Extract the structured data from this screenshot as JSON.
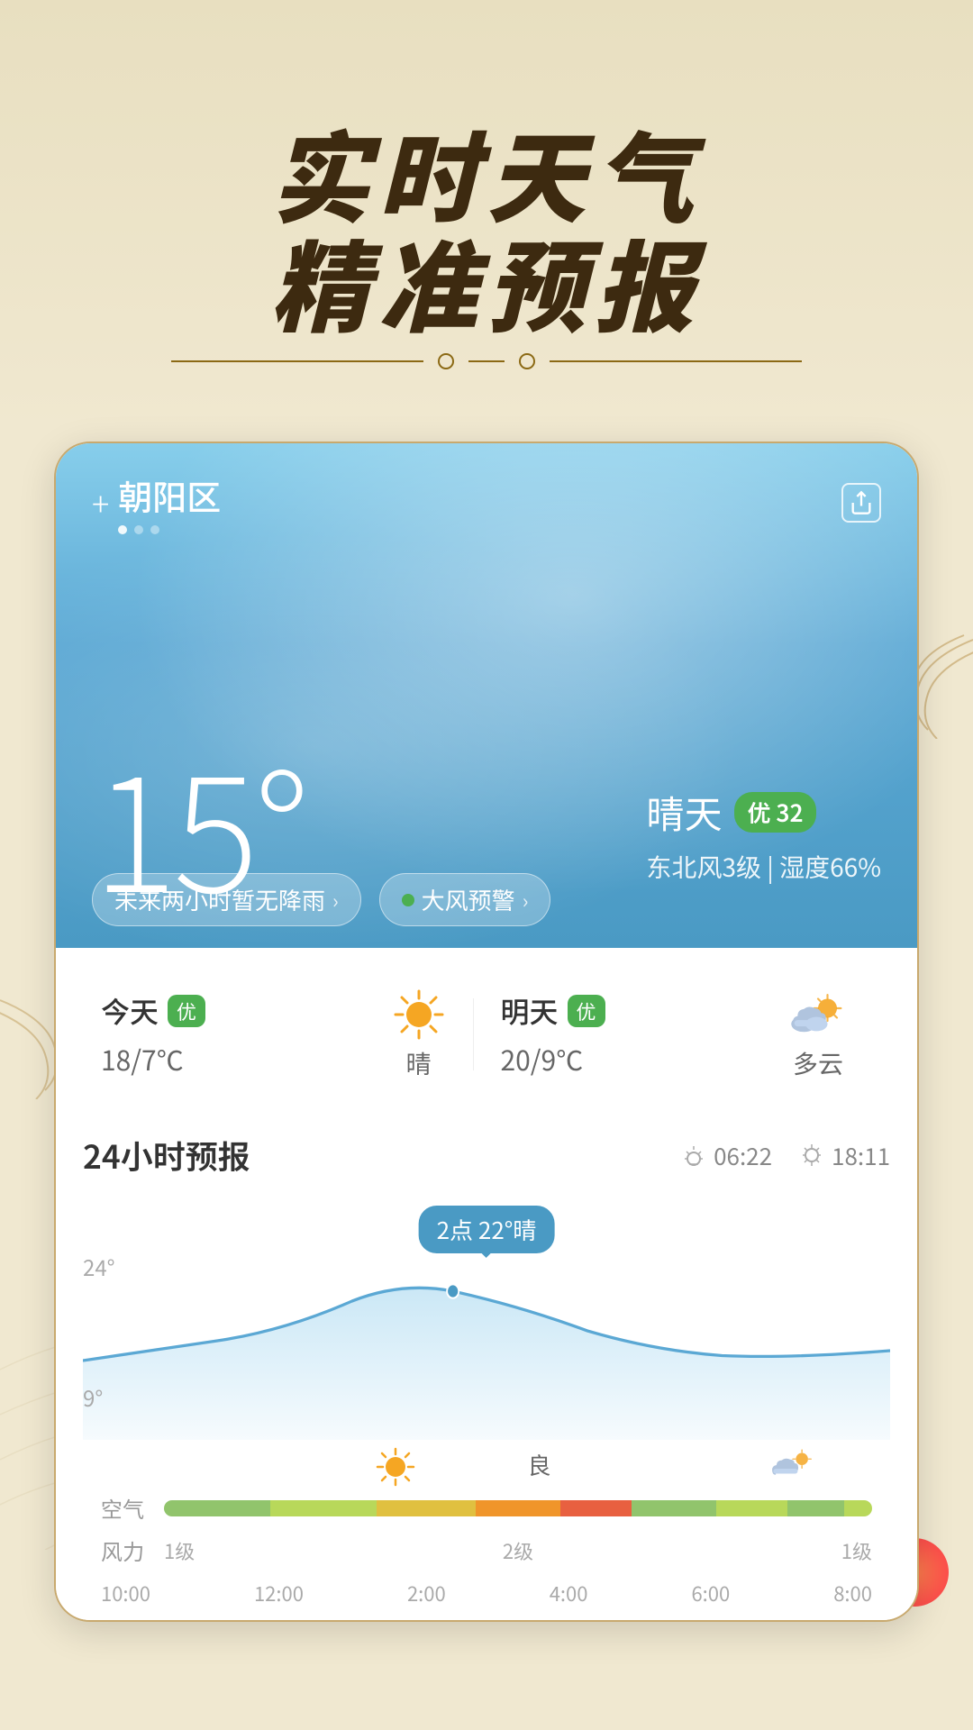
{
  "hero": {
    "title_main": "实时天气",
    "title_sub": "精准预报"
  },
  "weather": {
    "location": "朝阳区",
    "temperature": "15°",
    "condition": "晴天",
    "aqi_label": "优",
    "aqi_value": "32",
    "wind": "东北风3级",
    "humidity": "湿度66%",
    "separator": "|",
    "alert1": "未来两小时暂无降雨",
    "alert2": "大风预警",
    "arrow": "›",
    "share_icon": "⬡",
    "plus_icon": "+",
    "dots": [
      1,
      2,
      3
    ]
  },
  "daily_forecast": {
    "today_label": "今天",
    "today_badge": "优",
    "today_temp": "18/7℃",
    "today_condition": "晴",
    "tomorrow_label": "明天",
    "tomorrow_badge": "优",
    "tomorrow_temp": "20/9℃",
    "tomorrow_condition": "多云"
  },
  "forecast_24h": {
    "title": "24小时预报",
    "sunrise_icon": "☀",
    "sunrise_time": "06:22",
    "sunset_icon": "🌅",
    "sunset_time": "18:11",
    "tooltip": "2点 22°晴",
    "y_labels": [
      "24°",
      "9°"
    ],
    "times": [
      "10:00",
      "12:00",
      "2:00",
      "4:00",
      "6:00",
      "8:00"
    ],
    "wind_levels": [
      "1级",
      "",
      "2级",
      "",
      "1级"
    ],
    "air_label": "空气",
    "wind_label": "风力"
  }
}
